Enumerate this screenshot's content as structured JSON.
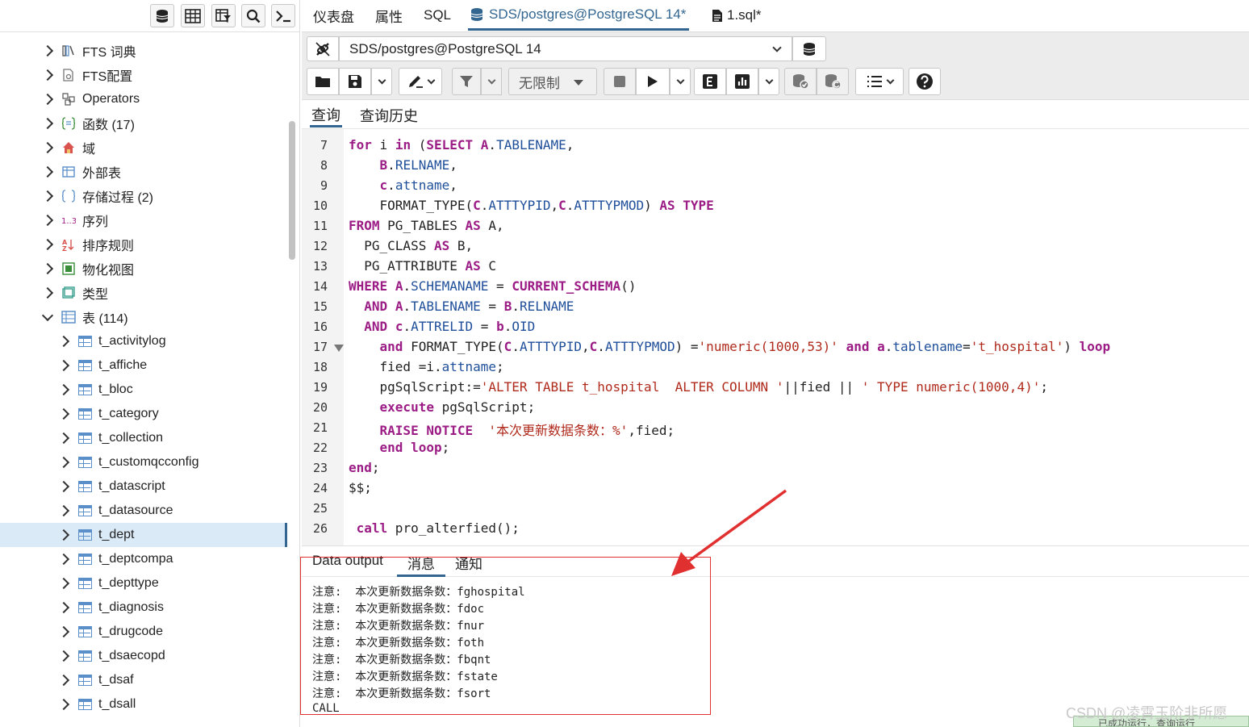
{
  "tabs": [
    {
      "label": "仪表盘"
    },
    {
      "label": "属性"
    },
    {
      "label": "SQL"
    },
    {
      "label": "SDS/postgres@PostgreSQL 14*"
    },
    {
      "label": "1.sql*"
    }
  ],
  "connection": {
    "label": "SDS/postgres@PostgreSQL 14"
  },
  "toolbar": {
    "limit_label": "无限制"
  },
  "subtabs": [
    {
      "label": "查询"
    },
    {
      "label": "查询历史"
    }
  ],
  "tree": [
    {
      "label": "FTS 词典",
      "icon": "fts-dictionary-icon"
    },
    {
      "label": "FTS配置",
      "icon": "fts-config-icon"
    },
    {
      "label": "Operators",
      "icon": "operators-icon"
    },
    {
      "label": "函数 (17)",
      "icon": "function-icon"
    },
    {
      "label": "域",
      "icon": "domain-icon"
    },
    {
      "label": "外部表",
      "icon": "foreign-table-icon"
    },
    {
      "label": "存储过程 (2)",
      "icon": "procedure-icon"
    },
    {
      "label": "序列",
      "icon": "sequence-icon"
    },
    {
      "label": "排序规则",
      "icon": "collation-icon"
    },
    {
      "label": "物化视图",
      "icon": "materialized-view-icon"
    },
    {
      "label": "类型",
      "icon": "type-icon"
    },
    {
      "label": "表 (114)",
      "icon": "tables-icon"
    },
    {
      "label": "t_activitylog"
    },
    {
      "label": "t_affiche"
    },
    {
      "label": "t_bloc"
    },
    {
      "label": "t_category"
    },
    {
      "label": "t_collection"
    },
    {
      "label": "t_customqcconfig"
    },
    {
      "label": "t_datascript"
    },
    {
      "label": "t_datasource"
    },
    {
      "label": "t_dept"
    },
    {
      "label": "t_deptcompa"
    },
    {
      "label": "t_depttype"
    },
    {
      "label": "t_diagnosis"
    },
    {
      "label": "t_drugcode"
    },
    {
      "label": "t_dsaecopd"
    },
    {
      "label": "t_dsaf"
    },
    {
      "label": "t_dsall"
    }
  ],
  "editor": {
    "lines": [
      {
        "n": "7",
        "code": "for i in (SELECT A.TABLENAME,"
      },
      {
        "n": "8",
        "code": "    B.RELNAME,"
      },
      {
        "n": "9",
        "code": "    c.attname,"
      },
      {
        "n": "10",
        "code": "    FORMAT_TYPE(C.ATTTYPID,C.ATTTYPMOD) AS TYPE"
      },
      {
        "n": "11",
        "code": "FROM PG_TABLES AS A,"
      },
      {
        "n": "12",
        "code": "  PG_CLASS AS B,"
      },
      {
        "n": "13",
        "code": "  PG_ATTRIBUTE AS C"
      },
      {
        "n": "14",
        "code": "WHERE A.SCHEMANAME = CURRENT_SCHEMA()"
      },
      {
        "n": "15",
        "code": "  AND A.TABLENAME = B.RELNAME"
      },
      {
        "n": "16",
        "code": "  AND c.ATTRELID = b.OID"
      },
      {
        "n": "17",
        "code": "    and FORMAT_TYPE(C.ATTTYPID,C.ATTTYPMOD) ='numeric(1000,53)' and a.tablename='t_hospital') loop"
      },
      {
        "n": "18",
        "code": "    fied =i.attname;"
      },
      {
        "n": "19",
        "code": "    pgSqlScript:='ALTER TABLE t_hospital  ALTER COLUMN '||fied || ' TYPE numeric(1000,4)';"
      },
      {
        "n": "20",
        "code": "    execute pgSqlScript;"
      },
      {
        "n": "21",
        "code": "    RAISE NOTICE  '本次更新数据条数：%',fied;"
      },
      {
        "n": "22",
        "code": "    end loop;"
      },
      {
        "n": "23",
        "code": "end;"
      },
      {
        "n": "24",
        "code": "$$;"
      },
      {
        "n": "25",
        "code": ""
      },
      {
        "n": "26",
        "code": " call pro_alterfied();"
      }
    ]
  },
  "output": {
    "tabs": [
      {
        "label": "Data output"
      },
      {
        "label": "消息"
      },
      {
        "label": "通知"
      }
    ],
    "messages": [
      "注意:  本次更新数据条数：fghospital",
      "注意:  本次更新数据条数：fdoc",
      "注意:  本次更新数据条数：fnur",
      "注意:  本次更新数据条数：foth",
      "注意:  本次更新数据条数：fbqnt",
      "注意:  本次更新数据条数：fstate",
      "注意:  本次更新数据条数：fsort",
      "CALL"
    ]
  },
  "watermark": "CSDN @凌霄玉阶非所愿",
  "status_text": "已成功运行，查询运行",
  "colors": {
    "accent": "#326690",
    "keyword": "#9c1c86",
    "identifier": "#1f4f9a",
    "string": "#b02a1c",
    "annotation": "#e03030"
  }
}
